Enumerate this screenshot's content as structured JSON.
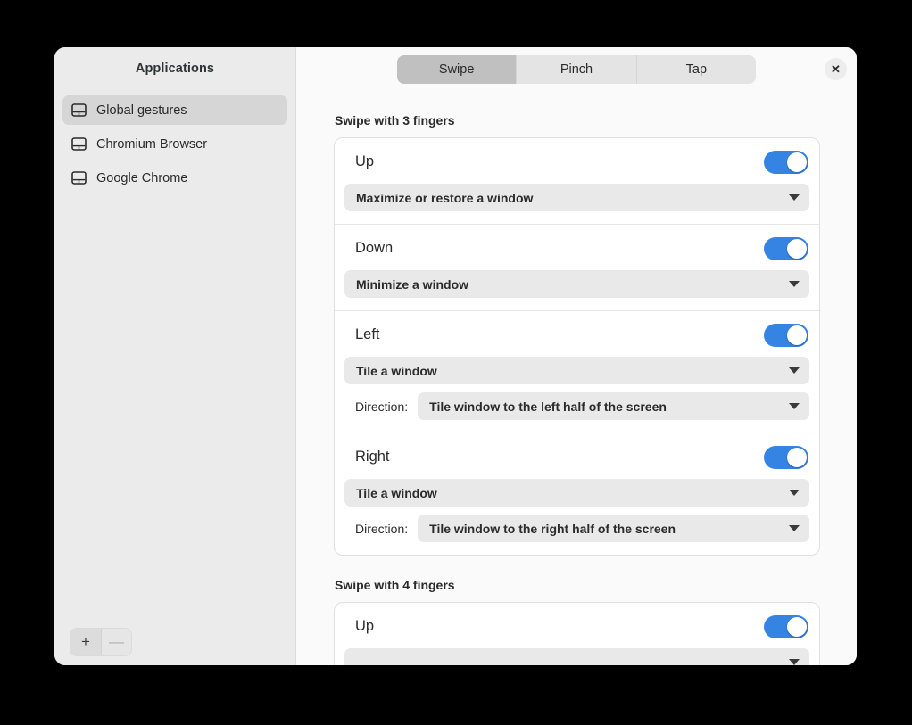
{
  "window": {
    "close_label": "✕"
  },
  "sidebar": {
    "title": "Applications",
    "items": [
      {
        "label": "Global gestures",
        "icon": "touchpad-icon",
        "selected": true
      },
      {
        "label": "Chromium Browser",
        "icon": "touchpad-icon",
        "selected": false
      },
      {
        "label": "Google Chrome",
        "icon": "touchpad-icon",
        "selected": false
      }
    ],
    "footer": {
      "add_label": "+",
      "remove_label": "—"
    }
  },
  "tabs": [
    {
      "label": "Swipe",
      "active": true
    },
    {
      "label": "Pinch",
      "active": false
    },
    {
      "label": "Tap",
      "active": false
    }
  ],
  "sections": [
    {
      "title": "Swipe with 3 fingers",
      "rows": [
        {
          "label": "Up",
          "enabled": true,
          "action": "Maximize or restore a window",
          "sub": null
        },
        {
          "label": "Down",
          "enabled": true,
          "action": "Minimize a window",
          "sub": null
        },
        {
          "label": "Left",
          "enabled": true,
          "action": "Tile a window",
          "sub": {
            "label": "Direction:",
            "value": "Tile window to the left half of the screen"
          }
        },
        {
          "label": "Right",
          "enabled": true,
          "action": "Tile a window",
          "sub": {
            "label": "Direction:",
            "value": "Tile window to the right half of the screen"
          }
        }
      ]
    },
    {
      "title": "Swipe with 4 fingers",
      "rows": [
        {
          "label": "Up",
          "enabled": true,
          "action": "",
          "sub": null
        }
      ]
    }
  ],
  "colors": {
    "accent": "#3584e4",
    "sidebar_bg": "#ebebeb",
    "content_bg": "#fafafa",
    "selected_row": "#d6d6d6",
    "tab_active": "#c0c0c0",
    "dropdown_bg": "#e9e9e9"
  }
}
